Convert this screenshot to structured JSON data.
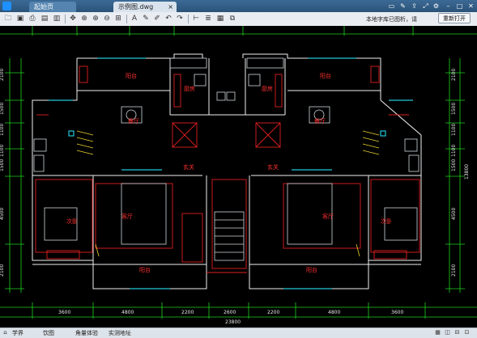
{
  "tabs": [
    {
      "label": "起始页"
    },
    {
      "label": "示例图.dwg"
    }
  ],
  "window": {
    "settings": "⚙",
    "minimize": "–",
    "maximize": "□",
    "close": "✕"
  },
  "toolbar": {
    "hint": "本地字库已图析，请",
    "reopen_label": "重新打开"
  },
  "rooms": {
    "balcony_top": "阳台",
    "kitchen": "厨房",
    "dining": "餐厅",
    "foyer": "玄关",
    "living": "客厅",
    "bedroom": "次卧",
    "balcony_bottom": "阳台"
  },
  "dims": {
    "top": [
      "2100",
      "1500",
      "1100",
      "1100",
      "1500",
      "4500",
      "2100"
    ],
    "right_total": "13800",
    "bottom": [
      "3600",
      "4800",
      "2200",
      "2600",
      "2200",
      "4800",
      "3600"
    ],
    "bottom_total": "23800"
  },
  "statusbar": {
    "items": [
      "学界",
      "饮图",
      "角量体验",
      "实测地址"
    ]
  }
}
